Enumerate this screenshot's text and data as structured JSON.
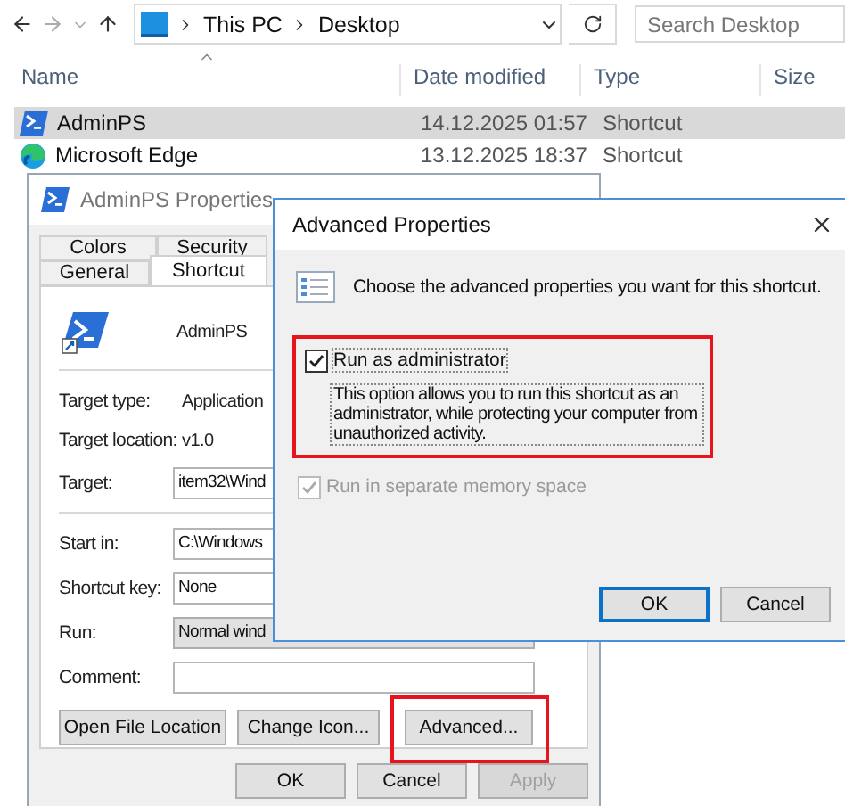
{
  "explorer": {
    "breadcrumb": [
      "This PC",
      "Desktop"
    ],
    "search": {
      "placeholder": "Search Desktop"
    },
    "columns": [
      "Name",
      "Date modified",
      "Type",
      "Size"
    ],
    "rows": [
      {
        "name": "AdminPS",
        "date": "14.12.2025 01:57",
        "type": "Shortcut",
        "kind": "powershell",
        "selected": true
      },
      {
        "name": "Microsoft Edge",
        "date": "13.12.2025 18:37",
        "type": "Shortcut",
        "kind": "edge",
        "selected": false
      }
    ]
  },
  "properties": {
    "title": "AdminPS Properties",
    "tab_rows": [
      [
        {
          "label": "Colors",
          "selected": false
        },
        {
          "label": "Security",
          "selected": false
        }
      ],
      [
        {
          "label": "General",
          "selected": false
        },
        {
          "label": "Shortcut",
          "selected": true
        }
      ]
    ],
    "name": "AdminPS",
    "info": [
      {
        "label": "Target type:",
        "value": "Application"
      },
      {
        "label": "Target location:",
        "value": "v1.0"
      }
    ],
    "fields": [
      {
        "label": "Target:",
        "value": "item32\\Wind",
        "kind": "text"
      },
      {
        "label": "Start in:",
        "value": "C:\\Windows",
        "kind": "text"
      },
      {
        "label": "Shortcut key:",
        "value": "None",
        "kind": "text"
      },
      {
        "label": "Run:",
        "value": "Normal wind",
        "kind": "select"
      },
      {
        "label": "Comment:",
        "kind": "text"
      }
    ],
    "actions": [
      {
        "label": "Open File Location",
        "highlighted": false
      },
      {
        "label": "Change Icon...",
        "highlighted": false
      },
      {
        "label": "Advanced...",
        "highlighted": true
      }
    ],
    "buttons": [
      {
        "label": "OK",
        "disabled": false
      },
      {
        "label": "Cancel",
        "disabled": false
      },
      {
        "label": "Apply",
        "disabled": true
      }
    ]
  },
  "advanced": {
    "title": "Advanced Properties",
    "intro": "Choose the advanced properties you want for this shortcut.",
    "options": [
      {
        "label": "Run as administrator",
        "checked": true,
        "disabled": false,
        "highlighted": true,
        "description": "This option allows you to run this shortcut as an administrator, while protecting your computer from unauthorized activity."
      },
      {
        "label": "Run in separate memory space",
        "checked": true,
        "disabled": true,
        "highlighted": false
      }
    ],
    "buttons": [
      {
        "label": "OK",
        "default": true
      },
      {
        "label": "Cancel",
        "default": false
      }
    ]
  }
}
